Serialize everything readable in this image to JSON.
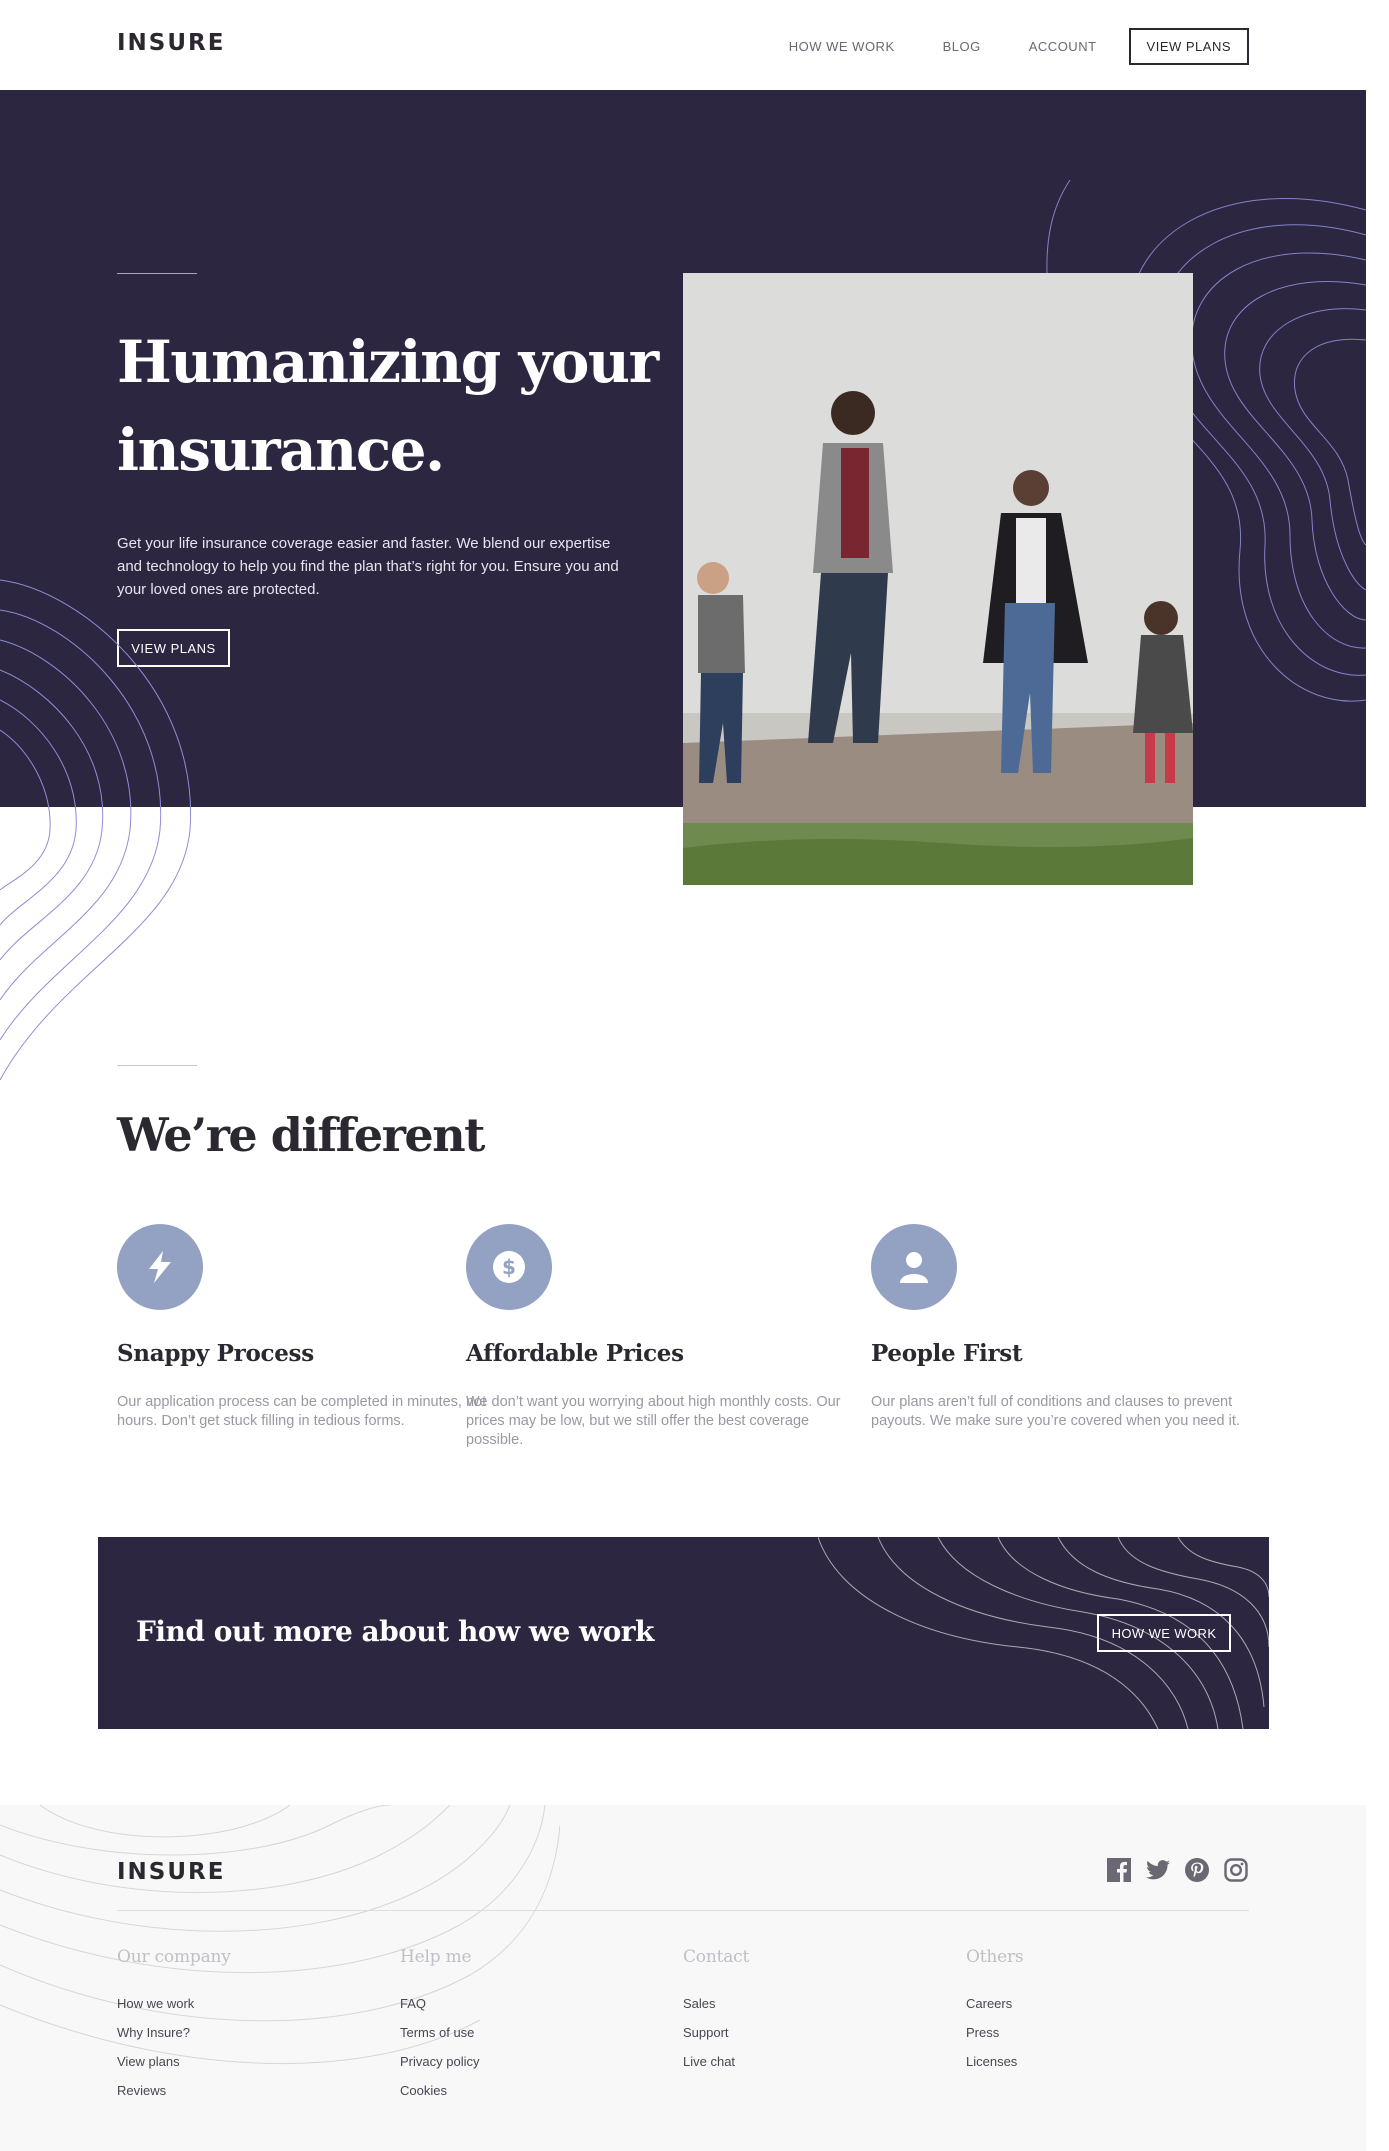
{
  "header": {
    "logo": "INSURE",
    "nav": [
      {
        "label": "HOW WE WORK"
      },
      {
        "label": "BLOG"
      },
      {
        "label": "ACCOUNT"
      }
    ],
    "cta_label": "VIEW PLANS"
  },
  "hero": {
    "title_line1": "Humanizing your",
    "title_line2": "insurance.",
    "description": "Get your life insurance coverage easier and faster. We blend our expertise and technology to help you find the plan that’s right for you. Ensure you and your loved ones are protected.",
    "button_label": "VIEW PLANS"
  },
  "different": {
    "title": "We’re different",
    "features": [
      {
        "icon": "lightning-icon",
        "title": "Snappy Process",
        "description": "Our application process can be completed in minutes, not hours. Don’t get stuck filling in tedious forms."
      },
      {
        "icon": "dollar-icon",
        "title": "Affordable Prices",
        "description": "We don’t want you worrying about high monthly costs. Our prices may be low, but we still offer the best coverage possible."
      },
      {
        "icon": "person-icon",
        "title": "People First",
        "description": "Our plans aren’t full of conditions and clauses to prevent payouts. We make sure you’re covered when you need it."
      }
    ]
  },
  "cta": {
    "title": "Find out more about how we work",
    "button_label": "HOW WE WORK"
  },
  "footer": {
    "logo": "INSURE",
    "social": [
      "facebook-icon",
      "twitter-icon",
      "pinterest-icon",
      "instagram-icon"
    ],
    "columns": [
      {
        "title": "Our company",
        "links": [
          "How we work",
          "Why Insure?",
          "View plans",
          "Reviews"
        ]
      },
      {
        "title": "Help me",
        "links": [
          "FAQ",
          "Terms of use",
          "Privacy policy",
          "Cookies"
        ]
      },
      {
        "title": "Contact",
        "links": [
          "Sales",
          "Support",
          "Live chat"
        ]
      },
      {
        "title": "Others",
        "links": [
          "Careers",
          "Press",
          "Licenses"
        ]
      }
    ]
  },
  "colors": {
    "dark_violet": "#2c2640",
    "icon_blue": "#93a2c2",
    "text_grey": "#9b97a3",
    "footer_bg": "#f8f8f8"
  }
}
